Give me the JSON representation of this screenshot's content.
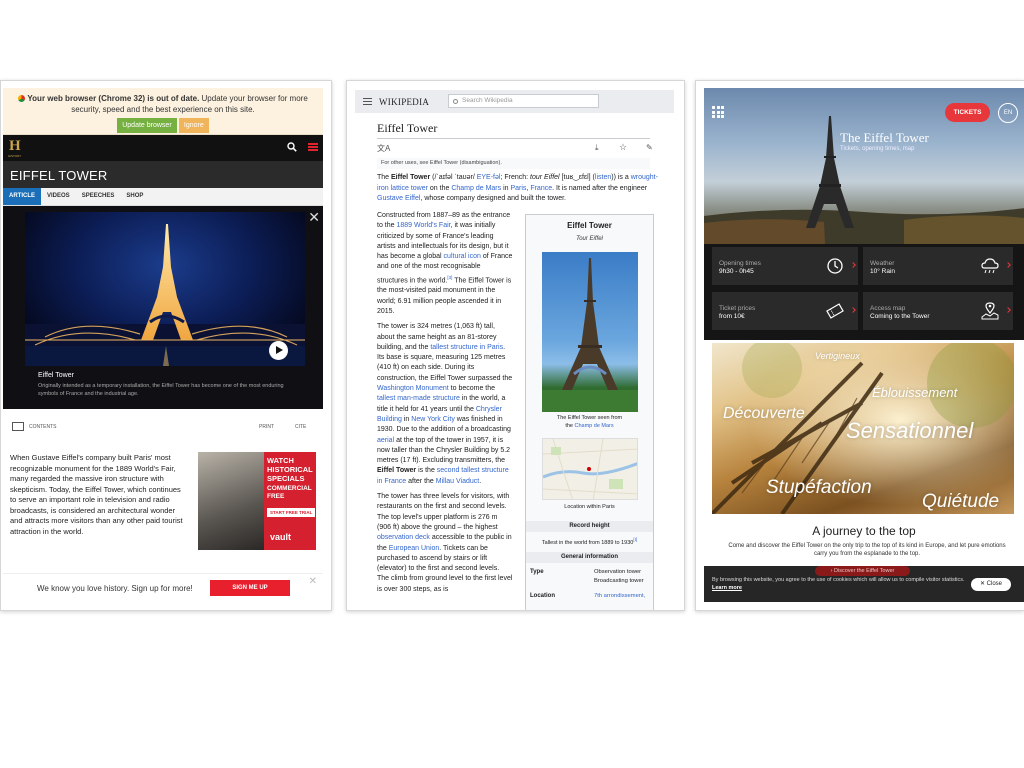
{
  "history": {
    "browser_warning": {
      "bold": "Your web browser (Chrome 32) is out of date.",
      "text": " Update your browser for more security, speed and the best experience on this site.",
      "update_button": "Update browser",
      "ignore_button": "Ignore"
    },
    "logo_letter": "H",
    "logo_sub": "HISTORY",
    "page_title": "EIFFEL TOWER",
    "tabs": [
      {
        "label": "ARTICLE",
        "active": true
      },
      {
        "label": "VIDEOS",
        "active": false
      },
      {
        "label": "SPEECHES",
        "active": false
      },
      {
        "label": "SHOP",
        "active": false
      }
    ],
    "video": {
      "caption_title": "Eiffel Tower",
      "caption_desc": "Originally intended as a temporary installation, the Eiffel Tower has become one of the most enduring symbols of France and the industrial age."
    },
    "tools": {
      "contents": "CONTENTS",
      "print": "PRINT",
      "cite": "CITE"
    },
    "article_text": "When Gustave Eiffel's company built Paris' most recognizable monument for the 1889 World's Fair, many regarded the massive iron structure with skepticism. Today, the Eiffel Tower, which continues to serve an important role in television and radio broadcasts, is considered an architectural wonder and attracts more visitors than any other paid tourist attraction in the world.",
    "ad": {
      "headline": "WATCH HISTORICAL SPECIALS",
      "sub": "COMMERCIAL FREE",
      "cta": "START FREE TRIAL",
      "brand": "vault"
    },
    "signup": {
      "text": "We know you love history. Sign up for more!",
      "button": "SIGN ME UP"
    }
  },
  "wikipedia": {
    "logo": "WIKIPEDIA",
    "search_placeholder": "Search Wikipedia",
    "title": "Eiffel Tower",
    "hatnote": "For other uses, see Eiffel Tower (disambiguation).",
    "lead": {
      "a": "The ",
      "b": "Eiffel Tower",
      "c": " (/ˈaɪfəl ˈtaʊər/ ",
      "d": "EYE-fəl",
      "e": "; French: ",
      "f": "tour Eiffel",
      "g": " [tuʁ‿ɛfɛl] (",
      "h": "listen",
      "i": ")) is a ",
      "j": "wrought-iron lattice tower",
      "k": " on the ",
      "l": "Champ de Mars",
      "m": " in ",
      "n": "Paris",
      "o": ", ",
      "p": "France",
      "q": ". It is named after the engineer ",
      "r": "Gustave Eiffel",
      "s": ", whose company designed and built the tower."
    },
    "para1": {
      "a": "Constructed from 1887–89 as the entrance to the ",
      "b": "1889 World's Fair",
      "c": ", it was initially criticized by some of France's leading artists and intellectuals for its design, but it has become a global ",
      "d": "cultural icon",
      "e": " of France and one of the most recognisable structures in the world.",
      "f": "[3]",
      "g": " The Eiffel Tower is the most-visited paid monument in the world; 6.91 million people ascended it in 2015."
    },
    "para2": {
      "a": "The tower is 324 metres (1,063 ft) tall, about the same height as an 81-storey building, and the ",
      "b": "tallest structure in Paris",
      "c": ". Its base is square, measuring 125 metres (410 ft) on each side. During its construction, the Eiffel Tower surpassed the ",
      "d": "Washington Monument",
      "e": " to become the ",
      "f": "tallest man-made structure",
      "g": " in the world, a title it held for 41 years until the ",
      "h": "Chrysler Building",
      "i": " in ",
      "j": "New York City",
      "k": " was finished in 1930. Due to the addition of a broadcasting ",
      "l": "aerial",
      "m": " at the top of the tower in 1957, it is now taller than the Chrysler Building by 5.2 metres (17 ft). Excluding transmitters, the ",
      "n": "Eiffel Tower",
      "o": " is the ",
      "p": "second tallest structure in France",
      "q": " after the ",
      "r": "Millau Viaduct",
      "s": "."
    },
    "para3": {
      "a": "The tower has three levels for visitors, with restaurants on the first and second levels. The top level's upper platform is 276 m (906 ft) above the ground – the highest ",
      "b": "observation deck",
      "c": " accessible to the public in the ",
      "d": "European Union",
      "e": ". Tickets can be purchased to ascend by stairs or lift (elevator) to the first and second levels. The climb from ground level to the first level is over 300 steps, as is"
    },
    "infobox": {
      "title": "Eiffel Tower",
      "native_name": "Tour Eiffel",
      "photo_caption_a": "The Eiffel Tower seen from",
      "photo_caption_b": "the ",
      "photo_caption_link": "Champ de Mars",
      "map_caption": "Location within Paris",
      "record_header": "Record height",
      "record_text": "Tallest in the world from 1889 to 1930",
      "record_ref": "[I]",
      "general_header": "General information",
      "rows": [
        {
          "label": "Type",
          "value": "Observation tower\nBroadcasting tower"
        },
        {
          "label": "Location",
          "value": "7th arrondissement,"
        }
      ]
    }
  },
  "official": {
    "tickets_button": "TICKETS",
    "language": "EN",
    "hero_title": "The Eiffel Tower",
    "hero_sub": "Tickets, opening times, map",
    "cards": [
      {
        "label": "Opening times",
        "value": "9h30 - 0h45",
        "icon": "clock-icon"
      },
      {
        "label": "Weather",
        "value": "10° Rain",
        "icon": "rain-cloud-icon"
      },
      {
        "label": "Ticket prices",
        "value": "from 10€",
        "icon": "ticket-icon"
      },
      {
        "label": "Access map",
        "value": "Coming to the Tower",
        "icon": "map-pin-icon"
      }
    ],
    "promo_words": [
      "Vertigineux",
      "Éblouissement",
      "Découverte",
      "Sensationnel",
      "Stupéfaction",
      "Quiétude"
    ],
    "journey_title": "A journey to the top",
    "journey_desc": "Come and discover the Eiffel Tower on the only trip to the top of its kind in Europe, and let pure emotions carry you from the esplanade to the top.",
    "discover_button": "› Discover the Eiffel Tower",
    "cookie_text": "By browsing this website, you agree to the use of cookies which will allow us to compile visitor statistics. ",
    "cookie_link": "Learn more",
    "cookie_close": "Close"
  }
}
